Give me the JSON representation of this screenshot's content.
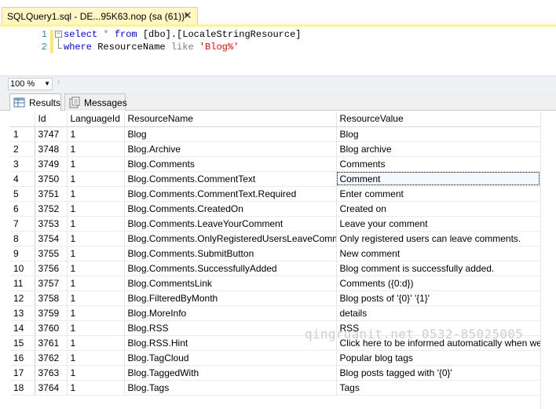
{
  "tab": {
    "title": "SQLQuery1.sql - DE...95K63.nop (sa (61))*",
    "close": "✕"
  },
  "editor": {
    "line_numbers": [
      "1",
      "2"
    ],
    "line1": {
      "select": "select",
      "star": " * ",
      "from": "from",
      "table": " [dbo].[LocaleStringResource]"
    },
    "line2": {
      "where": "where",
      "col": " ResourceName ",
      "like": "like",
      "value": " 'Blog%'"
    }
  },
  "zoom": {
    "value": "100 %"
  },
  "results_tabs": {
    "results": "Results",
    "messages": "Messages"
  },
  "grid": {
    "columns": [
      "Id",
      "LanguageId",
      "ResourceName",
      "ResourceValue"
    ],
    "rows": [
      [
        "1",
        "3747",
        "1",
        "Blog",
        "Blog"
      ],
      [
        "2",
        "3748",
        "1",
        "Blog.Archive",
        "Blog archive"
      ],
      [
        "3",
        "3749",
        "1",
        "Blog.Comments",
        "Comments"
      ],
      [
        "4",
        "3750",
        "1",
        "Blog.Comments.CommentText",
        "Comment"
      ],
      [
        "5",
        "3751",
        "1",
        "Blog.Comments.CommentText.Required",
        "Enter comment"
      ],
      [
        "6",
        "3752",
        "1",
        "Blog.Comments.CreatedOn",
        "Created on"
      ],
      [
        "7",
        "3753",
        "1",
        "Blog.Comments.LeaveYourComment",
        "Leave your comment"
      ],
      [
        "8",
        "3754",
        "1",
        "Blog.Comments.OnlyRegisteredUsersLeaveComments",
        "Only registered users can leave comments."
      ],
      [
        "9",
        "3755",
        "1",
        "Blog.Comments.SubmitButton",
        "New comment"
      ],
      [
        "10",
        "3756",
        "1",
        "Blog.Comments.SuccessfullyAdded",
        "Blog comment is successfully added."
      ],
      [
        "11",
        "3757",
        "1",
        "Blog.CommentsLink",
        "Comments ({0:d})"
      ],
      [
        "12",
        "3758",
        "1",
        "Blog.FilteredByMonth",
        "Blog posts of '{0}' '{1}'"
      ],
      [
        "13",
        "3759",
        "1",
        "Blog.MoreInfo",
        "details"
      ],
      [
        "14",
        "3760",
        "1",
        "Blog.RSS",
        "RSS"
      ],
      [
        "15",
        "3761",
        "1",
        "Blog.RSS.Hint",
        "Click here to be informed automatically when we ..."
      ],
      [
        "16",
        "3762",
        "1",
        "Blog.TagCloud",
        "Popular blog tags"
      ],
      [
        "17",
        "3763",
        "1",
        "Blog.TaggedWith",
        "Blog posts tagged with '{0}'"
      ],
      [
        "18",
        "3764",
        "1",
        "Blog.Tags",
        "Tags"
      ]
    ],
    "selected_row_index": 3,
    "selected_column": "ResourceValue"
  },
  "watermark": "qingruanit.net 0532-85025005",
  "icons": {
    "results": "grid-icon",
    "messages": "messages-icon",
    "close": "close-icon",
    "fold": "collapse-icon"
  },
  "colors": {
    "tab_active": "#fff8c4",
    "keyword": "#0000ff",
    "string": "#ff0000",
    "line_number": "#2b91af"
  }
}
